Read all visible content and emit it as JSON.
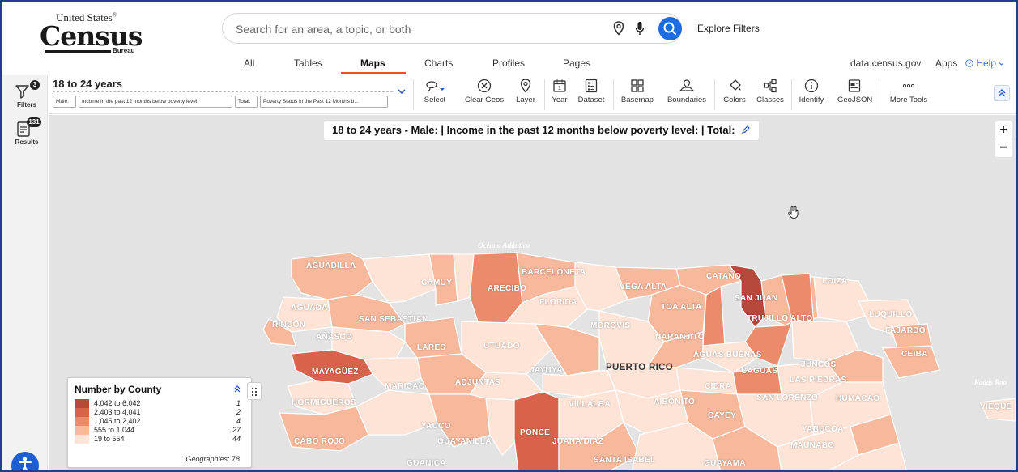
{
  "brand": {
    "line1": "United States",
    "registered": "®",
    "line2": "Census",
    "line3": "Bureau"
  },
  "search": {
    "placeholder": "Search for an area, a topic, or both",
    "explore_filters": "Explore Filters"
  },
  "nav": {
    "tabs": [
      "All",
      "Tables",
      "Maps",
      "Charts",
      "Profiles",
      "Pages"
    ],
    "active_tab": "Maps",
    "right": {
      "site": "data.census.gov",
      "apps": "Apps",
      "help": "Help"
    }
  },
  "rail": {
    "filters": {
      "label": "Filters",
      "count": "3"
    },
    "results": {
      "label": "Results",
      "count": "131"
    }
  },
  "toolbar": {
    "title": "18 to 24 years",
    "chips": [
      "Male:",
      "Income in the past 12 months below poverty level:",
      "Total:",
      "Poverty Status in the Past 12 Months b..."
    ],
    "tools": [
      "Select",
      "Clear Geos",
      "Layer",
      "Year",
      "Dataset",
      "Basemap",
      "Boundaries",
      "Colors",
      "Classes",
      "Identify",
      "GeoJSON",
      "More Tools"
    ],
    "year_glyph": "1"
  },
  "map": {
    "title": "18 to 24 years - Male: | Income in the past 12 months below poverty level: | Total:",
    "zoom_in": "+",
    "zoom_out": "−",
    "ocean_label": "Océano Atlántico",
    "region_label": "PUERTO RICO",
    "municipalities": [
      "AGUADILLA",
      "CAMUY",
      "BARCELONETA",
      "ARECIBO",
      "FLORIDA",
      "VEGA ALTA",
      "CATAÑO",
      "SAN JUAN",
      "LOIZA",
      "TOA ALTA",
      "TRUJILLO ALTO",
      "AGUADA",
      "SAN SEBASTIAN",
      "RINCÓN",
      "MOROVIS",
      "LUQUILLO",
      "FAJARDO",
      "AÑASCO",
      "NARANJITO",
      "LARES",
      "UTUADO",
      "AGUAS BUENAS",
      "CEIBA",
      "JUNCOS",
      "MAYAGÜEZ",
      "JAYUYA",
      "CAGUAS",
      "LAS PIEDRAS",
      "MARICAO",
      "ADJUNTAS",
      "CIDRA",
      "HORMIGUEROS",
      "VILLALBA",
      "AIBONITO",
      "SAN LORENZO",
      "HUMACAO",
      "CAYEY",
      "YAUCO",
      "PONCE",
      "YABUCOA",
      "CABO ROJO",
      "GUAYANILLA",
      "JUANA DIAZ",
      "MAUNABO",
      "GUÁNICA",
      "SANTA ISABEL",
      "GUAYAMA",
      "Radas Roo",
      "VIEQUE"
    ],
    "legend": {
      "title": "Number by County",
      "classes": [
        {
          "range": "4,042 to 6,042",
          "count": "1",
          "color": "#b8473c"
        },
        {
          "range": "2,403 to 4,041",
          "count": "2",
          "color": "#d9624c"
        },
        {
          "range": "1,045 to 2,402",
          "count": "4",
          "color": "#ec8b6c"
        },
        {
          "range": "555 to 1,044",
          "count": "27",
          "color": "#f7b89c"
        },
        {
          "range": "19 to 554",
          "count": "44",
          "color": "#fde4d6"
        }
      ],
      "geographies": "Geographies: 78"
    }
  },
  "colors": {
    "accent": "#1d6be0",
    "tab_underline": "#e8502a",
    "frame": "#1f3f95",
    "map_bg": "#e3e3e3"
  }
}
